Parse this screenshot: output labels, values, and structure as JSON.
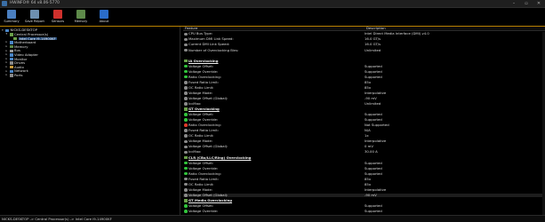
{
  "window": {
    "title": "HWiNFO® 64 v8.06-5770"
  },
  "toolbar": [
    {
      "label": "Summary",
      "icon": "summary-icon",
      "color": "#4a7fc0"
    },
    {
      "label": "Save Report",
      "icon": "save-report-icon",
      "color": "#6d8fb0"
    },
    {
      "label": "Sensors",
      "icon": "sensors-icon",
      "color": "#d0312d"
    },
    {
      "label": "Memory",
      "icon": "memory-icon",
      "color": "#5e8a4a"
    },
    {
      "label": "About",
      "icon": "about-icon",
      "color": "#2a6cc8"
    }
  ],
  "tree": [
    {
      "label": "NICKS-DESKTOP",
      "indent": 0,
      "toggle": "▾",
      "color": "#4a86c8"
    },
    {
      "label": "Central Processor(s)",
      "indent": 1,
      "toggle": "▾",
      "color": "#6aa04a"
    },
    {
      "label": "Intel Core i9-14900KF",
      "indent": 2,
      "toggle": "",
      "color": "#6aa04a",
      "selected": true
    },
    {
      "label": "Motherboard",
      "indent": 1,
      "toggle": "▸",
      "color": "#4a86c8"
    },
    {
      "label": "Memory",
      "indent": 1,
      "toggle": "▸",
      "color": "#5e8a4a"
    },
    {
      "label": "Bus",
      "indent": 1,
      "toggle": "▸",
      "color": "#9a9a9a"
    },
    {
      "label": "Video Adapter",
      "indent": 1,
      "toggle": "▸",
      "color": "#4a86c8"
    },
    {
      "label": "Monitor",
      "indent": 1,
      "toggle": "▸",
      "color": "#4a86c8"
    },
    {
      "label": "Drives",
      "indent": 1,
      "toggle": "▸",
      "color": "#8a8a8a"
    },
    {
      "label": "Audio",
      "indent": 1,
      "toggle": "▸",
      "color": "#c89a3a"
    },
    {
      "label": "Network",
      "indent": 1,
      "toggle": "▸",
      "color": "#4a86c8"
    },
    {
      "label": "Ports",
      "indent": 1,
      "toggle": "▸",
      "color": "#8a8a8a"
    }
  ],
  "columns": {
    "feature": "Feature",
    "description": "Description"
  },
  "rows": [
    {
      "feature": "CPU Bus Type:",
      "value": "Intel Direct Media Interface (DMI) v4.0",
      "icon": "grey"
    },
    {
      "feature": "Maximum DMI Link Speed:",
      "value": "16.0 GT/s",
      "icon": "grey"
    },
    {
      "feature": "Current DMI Link Speed:",
      "value": "16.0 GT/s",
      "icon": "grey"
    },
    {
      "feature": "Number of Overclocking Bins:",
      "value": "Unlimited",
      "icon": "grey"
    },
    {
      "feature": "",
      "value": "",
      "icon": ""
    },
    {
      "feature": "IA Overclocking",
      "value": "",
      "icon": "chip",
      "section": true
    },
    {
      "feature": "Voltage Offset:",
      "value": "Supported",
      "icon": "green"
    },
    {
      "feature": "Voltage Override:",
      "value": "Supported",
      "icon": "green"
    },
    {
      "feature": "Ratio Overclocking:",
      "value": "Supported",
      "icon": "green"
    },
    {
      "feature": "Fused Ratio Limit:",
      "value": "85x",
      "icon": "grey"
    },
    {
      "feature": "OC Ratio Limit:",
      "value": "85x",
      "icon": "grey"
    },
    {
      "feature": "Voltage Mode:",
      "value": "Interpolative",
      "icon": "grey"
    },
    {
      "feature": "Voltage Offset (Global):",
      "value": "-90 mV",
      "icon": "grey"
    },
    {
      "feature": "IccMax:",
      "value": "Unlimited",
      "icon": "grey"
    },
    {
      "feature": "GT Overclocking",
      "value": "",
      "icon": "chip",
      "section": true
    },
    {
      "feature": "Voltage Offset:",
      "value": "Supported",
      "icon": "green"
    },
    {
      "feature": "Voltage Override:",
      "value": "Supported",
      "icon": "green"
    },
    {
      "feature": "Ratio Overclocking:",
      "value": "Not Supported",
      "icon": "red"
    },
    {
      "feature": "Fused Ratio Limit:",
      "value": "N/A",
      "icon": "grey"
    },
    {
      "feature": "OC Ratio Limit:",
      "value": "1x",
      "icon": "grey"
    },
    {
      "feature": "Voltage Mode:",
      "value": "Interpolative",
      "icon": "grey"
    },
    {
      "feature": "Voltage Offset (Global):",
      "value": "0 mV",
      "icon": "grey"
    },
    {
      "feature": "IccMax:",
      "value": "30.00 A",
      "icon": "grey"
    },
    {
      "feature": "CLR (CBo/LLC/Ring) Overclocking",
      "value": "",
      "icon": "chip",
      "section": true
    },
    {
      "feature": "Voltage Offset:",
      "value": "Supported",
      "icon": "green"
    },
    {
      "feature": "Voltage Override:",
      "value": "Supported",
      "icon": "green"
    },
    {
      "feature": "Ratio Overclocking:",
      "value": "Supported",
      "icon": "green"
    },
    {
      "feature": "Fused Ratio Limit:",
      "value": "85x",
      "icon": "grey"
    },
    {
      "feature": "OC Ratio Limit:",
      "value": "85x",
      "icon": "grey"
    },
    {
      "feature": "Voltage Mode:",
      "value": "Interpolative",
      "icon": "grey"
    },
    {
      "feature": "Voltage Offset (Global):",
      "value": "-90 mV",
      "icon": "grey",
      "selected": true
    },
    {
      "feature": "GT Media Overclocking",
      "value": "",
      "icon": "chip",
      "section": true
    },
    {
      "feature": "Voltage Offset:",
      "value": "Supported",
      "icon": "green"
    },
    {
      "feature": "Voltage Override:",
      "value": "Supported",
      "icon": "green"
    }
  ],
  "status": {
    "path": "NICKS-DESKTOP -> Central Processor(s) -> Intel Core i9-14900KF"
  }
}
